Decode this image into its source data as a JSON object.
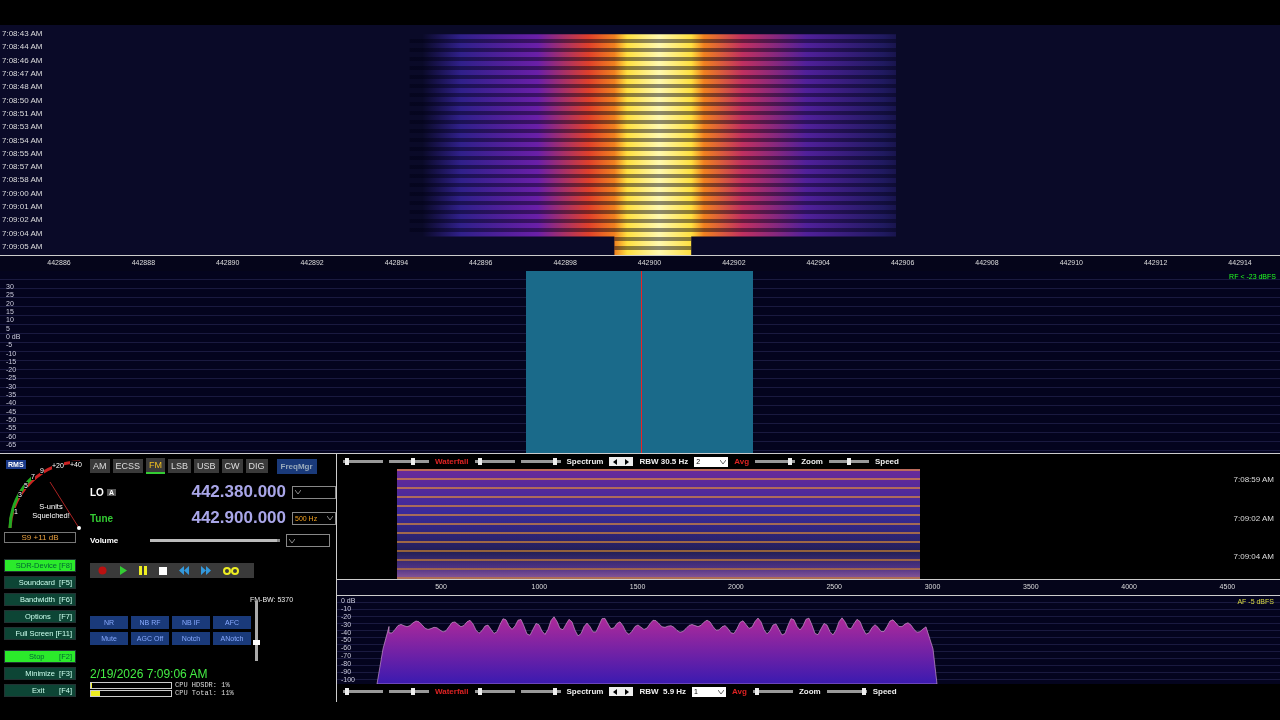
{
  "waterfall": {
    "times": [
      "7:08:43 AM",
      "7:08:44 AM",
      "7:08:46 AM",
      "7:08:47 AM",
      "7:08:48 AM",
      "7:08:50 AM",
      "7:08:51 AM",
      "7:08:53 AM",
      "7:08:54 AM",
      "7:08:55 AM",
      "7:08:57 AM",
      "7:08:58 AM",
      "7:09:00 AM",
      "7:09:01 AM",
      "7:09:02 AM",
      "7:09:04 AM",
      "7:09:05 AM"
    ]
  },
  "rf_axis": {
    "labels": [
      "442886",
      "442888",
      "442890",
      "442892",
      "442894",
      "442896",
      "442898",
      "442900",
      "442902",
      "442904",
      "442906",
      "442908",
      "442910",
      "442912",
      "442914"
    ],
    "level_reading": "RF < -23 dBFS"
  },
  "rf_spectrum": {
    "db_labels": [
      "30",
      "25",
      "20",
      "15",
      "10",
      "5",
      "0 dB",
      "-5",
      "-10",
      "-15",
      "-20",
      "-25",
      "-30",
      "-35",
      "-40",
      "-45",
      "-50",
      "-55",
      "-60",
      "-65"
    ]
  },
  "smeter": {
    "mode_label": "RMS",
    "scale": [
      "1",
      "3",
      "5",
      "7",
      "9",
      "+20",
      "+40"
    ],
    "status": "S-units Squelched!",
    "reading": "S9 +11 dB"
  },
  "modes": [
    {
      "label": "AM",
      "selected": false
    },
    {
      "label": "ECSS",
      "selected": false
    },
    {
      "label": "FM",
      "selected": true
    },
    {
      "label": "LSB",
      "selected": false
    },
    {
      "label": "USB",
      "selected": false
    },
    {
      "label": "CW",
      "selected": false
    },
    {
      "label": "DIG",
      "selected": false
    }
  ],
  "freq_manager": "FreqMgr",
  "lo": {
    "label": "LO",
    "badge": "A",
    "value": "442.380.000"
  },
  "tune": {
    "label": "Tune",
    "value": "442.900.000",
    "step": "500 Hz"
  },
  "volume": {
    "label": "Volume",
    "level": 0.98
  },
  "function_buttons": [
    {
      "label": "SDR-Device [F8]",
      "active": true
    },
    {
      "label": "Soundcard  [F5]",
      "active": false
    },
    {
      "label": "Bandwidth  [F6]",
      "active": false
    },
    {
      "label": "Options    [F7]",
      "active": false
    },
    {
      "label": "Full Screen [F11]",
      "active": false
    },
    {
      "label": "Stop       [F2]",
      "active": true
    },
    {
      "label": "Minimize  [F3]",
      "active": false
    },
    {
      "label": "Exit       [F4]",
      "active": false
    }
  ],
  "dsp_buttons": [
    "NR",
    "NB RF",
    "NB IF",
    "AFC",
    "Mute",
    "AGC Off",
    "Notch",
    "ANotch"
  ],
  "fm_bandwidth": {
    "label": "FM-BW: 5370",
    "level": 0.3
  },
  "datetime": "2/19/2026 7:09:06 AM",
  "cpu": [
    {
      "label": "CPU HDSDR: 1%",
      "level": 0.01
    },
    {
      "label": "CPU Total: 11%",
      "level": 0.11
    }
  ],
  "audio_toolbars": [
    {
      "waterfall_label": "Waterfall",
      "spectrum_label": "Spectrum",
      "rbw": "RBW 30.5 Hz",
      "avg_value": "2",
      "avg_label": "Avg",
      "zoom_label": "Zoom",
      "speed_label": "Speed",
      "sliders": [
        {
          "level": 0.05
        },
        {
          "level": 0.6
        },
        {
          "level": 0.1
        },
        {
          "level": 0.9
        },
        {
          "level": 0.9
        },
        {
          "level": 0.5
        }
      ]
    },
    {
      "waterfall_label": "Waterfall",
      "spectrum_label": "Spectrum",
      "rbw": "RBW  5.9 Hz",
      "avg_value": "1",
      "avg_label": "Avg",
      "zoom_label": "Zoom",
      "speed_label": "Speed",
      "sliders": [
        {
          "level": 0.05
        },
        {
          "level": 0.6
        },
        {
          "level": 0.1
        },
        {
          "level": 0.9
        },
        {
          "level": 0.05
        },
        {
          "level": 0.98
        }
      ]
    }
  ],
  "audio_waterfall": {
    "times": [
      "7:08:59 AM",
      "7:09:02 AM",
      "7:09:04 AM"
    ]
  },
  "af_axis": {
    "labels": [
      "500",
      "1000",
      "1500",
      "2000",
      "2500",
      "3000",
      "3500",
      "4000",
      "4500"
    ],
    "level_reading": "AF -5 dBFS"
  },
  "af_spectrum": {
    "db_labels": [
      "0 dB",
      "-10",
      "-20",
      "-30",
      "-40",
      "-50",
      "-60",
      "-70",
      "-80",
      "-90",
      "-100"
    ]
  }
}
